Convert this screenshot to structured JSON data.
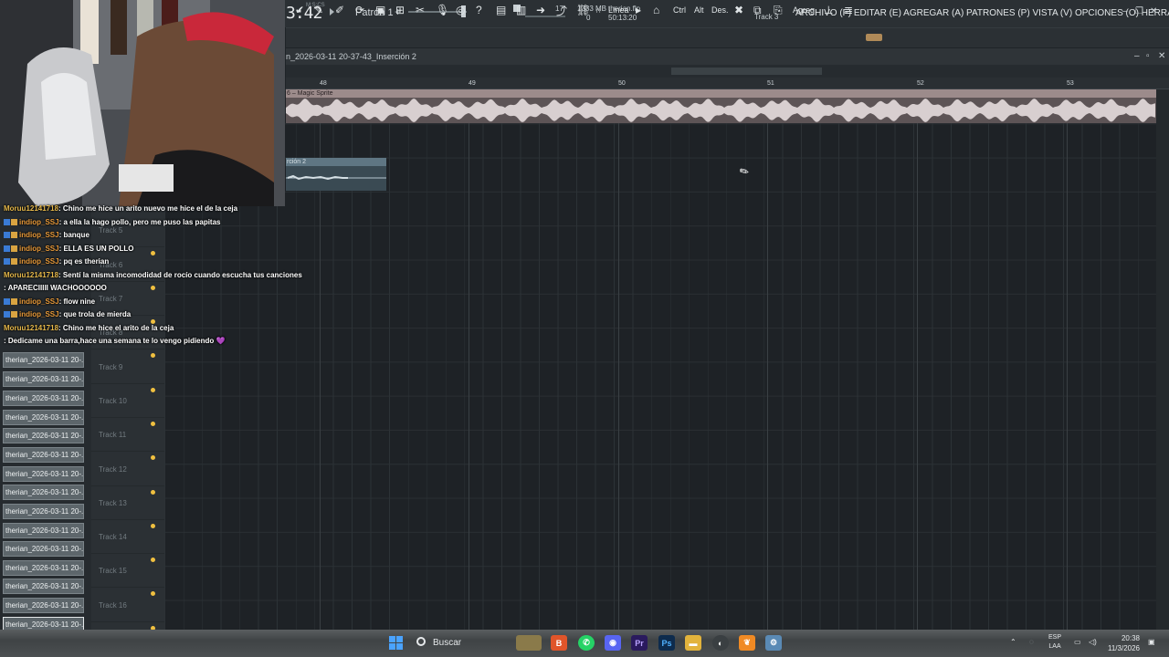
{
  "transport": {
    "time": "3:42",
    "time_marker": "M:S:CS",
    "pattern": "Patrón 1"
  },
  "monitor": {
    "cpu": "17",
    "cpu_zero": "0",
    "memory": "1333 MB"
  },
  "project": {
    "file": "therian.flp",
    "elapsed": "50:13:20",
    "hint_track": "Track 3"
  },
  "menu": "ARCHIVO (F) EDITAR (E) AGREGAR (A) PATRONES (P) VISTA (V) OPCIONES (O) HERRAMIENTAS (T) AYUDA",
  "toolbar": {
    "line_label": "Línea",
    "ctrl": "Ctrl",
    "alt": "Alt",
    "des": "Des.",
    "agreg": "Agreg."
  },
  "playlist": {
    "title": "n_2026-03-11 20-37-43_Inserción 2",
    "ruler": [
      "48",
      "49",
      "50",
      "51",
      "52",
      "53"
    ],
    "clip1_name": "6 – Magic Sprite",
    "clip2_name": "rción 2"
  },
  "tracks": [
    "Track 5",
    "Track 6",
    "Track 7",
    "Track 8",
    "Track 9",
    "Track 10",
    "Track 11",
    "Track 12",
    "Track 13",
    "Track 14",
    "Track 15",
    "Track 16"
  ],
  "patterns": [
    "therian_2026-03-11 20-...",
    "therian_2026-03-11 20-...",
    "therian_2026-03-11 20-...",
    "therian_2026-03-11 20-...",
    "therian_2026-03-11 20-...",
    "therian_2026-03-11 20-...",
    "therian_2026-03-11 20-...",
    "therian_2026-03-11 20-...",
    "therian_2026-03-11 20-...",
    "therian_2026-03-11 20-...",
    "therian_2026-03-11 20-...",
    "therian_2026-03-11 20-...",
    "therian_2026-03-11 20-...",
    "therian_2026-03-11 20-...",
    "therian_2026-03-11 20-..."
  ],
  "chat": [
    {
      "user": "Moruu12141718",
      "text": ": Chino me hice un arito nuevo me hice el de la ceja",
      "style": "a"
    },
    {
      "user": "indiop_SSJ",
      "text": ": a ella la hago pollo, pero me puso las papitas",
      "style": "b"
    },
    {
      "user": "indiop_SSJ",
      "text": ": banque",
      "style": "b"
    },
    {
      "user": "indiop_SSJ",
      "text": ": ELLA ES UN POLLO",
      "style": "b"
    },
    {
      "user": "indiop_SSJ",
      "text": ": pq es therian",
      "style": "b"
    },
    {
      "user": "Moruu12141718",
      "text": ": Sentí la misma incomodidad de rocío cuando escucha tus canciones",
      "style": "a"
    },
    {
      "user": "",
      "text": ": APARECIIIII WACHOOOOOO",
      "style": "c"
    },
    {
      "user": "indiop_SSJ",
      "text": ": flow nine",
      "style": "b"
    },
    {
      "user": "indiop_SSJ",
      "text": ": que trola de mierda",
      "style": "b"
    },
    {
      "user": "Moruu12141718",
      "text": ": Chino me hice el arito de la ceja",
      "style": "a"
    },
    {
      "user": "",
      "text": ": Dedicame una barra,hace una semana te lo vengo pidiendo 💜",
      "style": "c"
    }
  ],
  "taskbar": {
    "search": "Buscar",
    "lang_top": "ESP",
    "lang_bottom": "LAA",
    "time": "20:38",
    "date": "11/3/2026"
  }
}
